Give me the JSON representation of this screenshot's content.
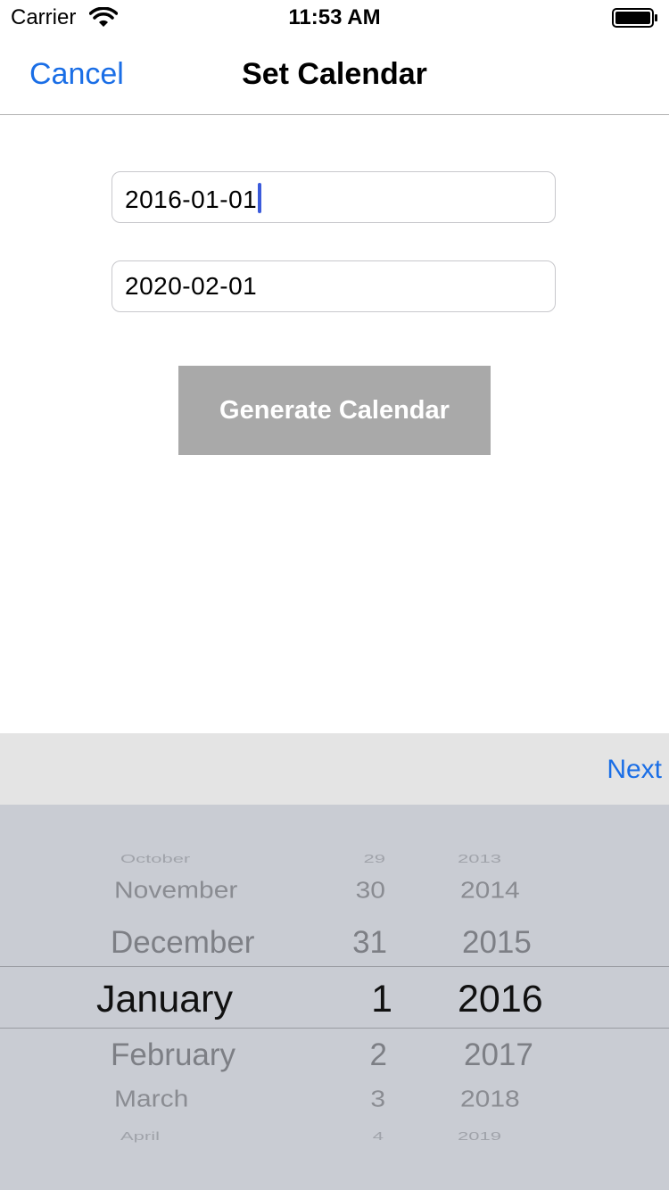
{
  "status_bar": {
    "carrier": "Carrier",
    "time": "11:53 AM"
  },
  "nav": {
    "cancel_label": "Cancel",
    "title": "Set Calendar"
  },
  "form": {
    "start_date_value": "2016-01-01",
    "end_date_value": "2020-02-01",
    "generate_label": "Generate Calendar"
  },
  "toolbar": {
    "next_label": "Next"
  },
  "picker": {
    "months": [
      "October",
      "November",
      "December",
      "January",
      "February",
      "March",
      "April"
    ],
    "days": [
      "29",
      "30",
      "31",
      "1",
      "2",
      "3",
      "4"
    ],
    "years": [
      "2013",
      "2014",
      "2015",
      "2016",
      "2017",
      "2018",
      "2019"
    ],
    "selected": {
      "month": "January",
      "day": "1",
      "year": "2016"
    }
  },
  "colors": {
    "accent": "#1a6ee6",
    "button_disabled": "#a9a9a9",
    "picker_bg": "#c9ccd3",
    "toolbar_bg": "#e4e4e4"
  }
}
